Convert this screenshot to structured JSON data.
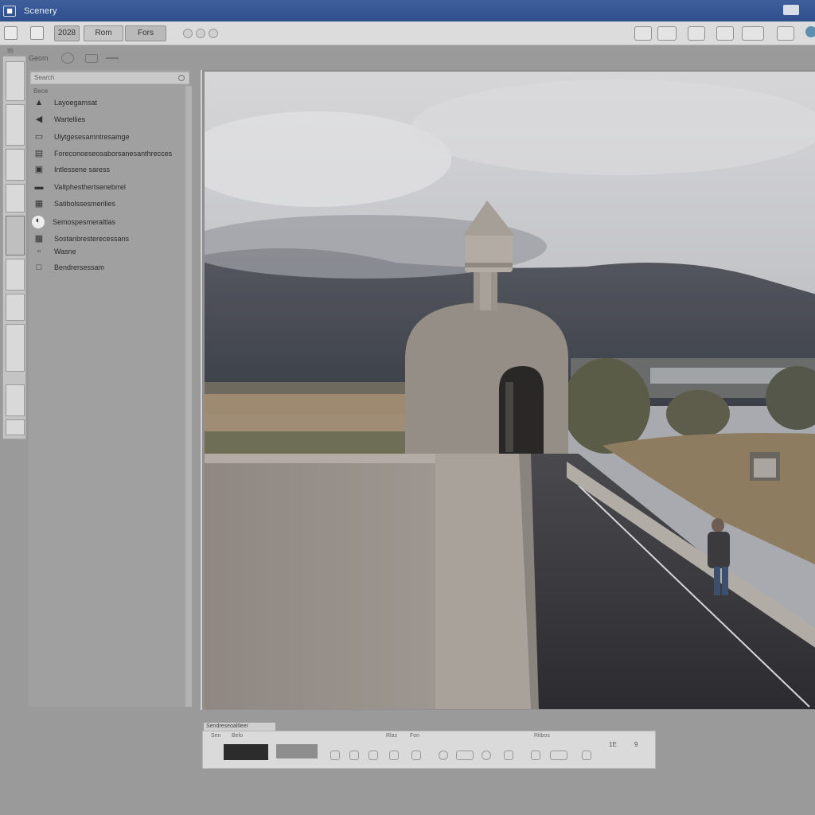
{
  "window": {
    "title": "Scenery",
    "app_icon": "app-icon"
  },
  "toolbar": {
    "btn1_label": "2028",
    "btn2_label": "Rom",
    "btn3_label": "Fors"
  },
  "subrow": {
    "label": "Geom"
  },
  "thumb_label": "35",
  "layers_panel": {
    "search_placeholder": "Search",
    "sub_label": "Bece",
    "items": [
      {
        "icon": "shape-icon",
        "label": "Layoegamsat"
      },
      {
        "icon": "arrow-icon",
        "label": "Wartellies"
      },
      {
        "icon": "image-icon",
        "label": "Ulytgesesamntresamge"
      },
      {
        "icon": "layer-icon",
        "label": "Foreconoeseosaborsanesanthrecces"
      },
      {
        "icon": "picture-icon",
        "label": "Intlessene saress"
      },
      {
        "icon": "folder-icon",
        "label": "Valtphesthertsenebrrel"
      },
      {
        "icon": "text-icon",
        "label": "Satibolssesmerilies"
      },
      {
        "icon": "circle-icon",
        "label": "Semospesmeraltlas"
      },
      {
        "icon": "adjust-icon",
        "label": "Sostanbresterecessans"
      },
      {
        "icon": "small-icon",
        "label": "Wasne"
      },
      {
        "icon": "box-icon",
        "label": "Bendrersessam"
      }
    ]
  },
  "timeline": {
    "label": "Sendreseoaltleer",
    "texts": [
      "Sen",
      "Belo",
      "Rlas",
      "Fon",
      "Ritbos"
    ],
    "num1": "1E",
    "num2": "9"
  }
}
